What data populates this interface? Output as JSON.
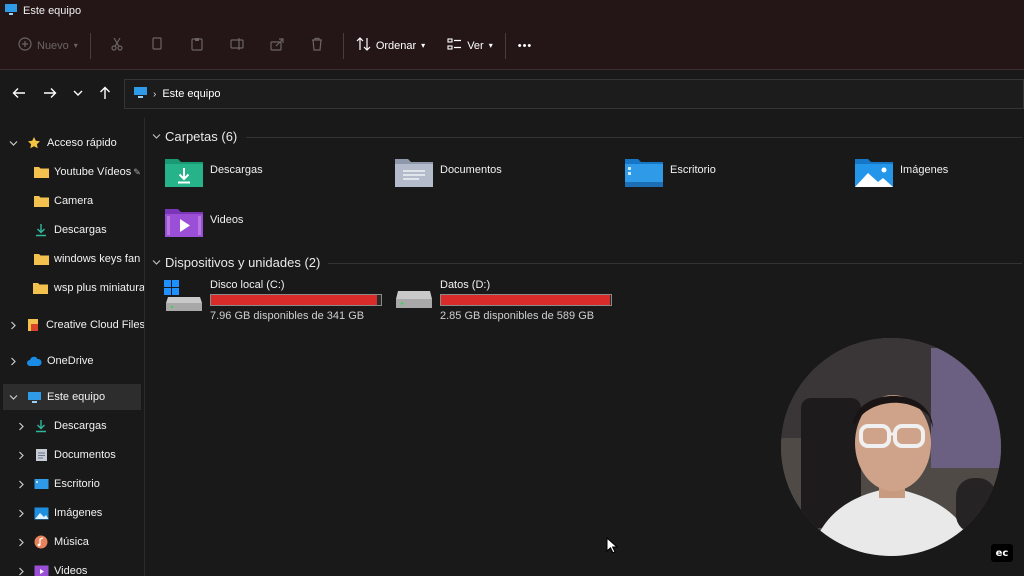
{
  "window": {
    "title": "Este equipo"
  },
  "toolbar": {
    "new_label": "Nuevo",
    "sort_label": "Ordenar",
    "view_label": "Ver",
    "more_label": "•••"
  },
  "address": {
    "crumb": "Este equipo"
  },
  "sidebar": {
    "items": [
      {
        "label": "Acceso rápido",
        "icon": "star-icon"
      },
      {
        "label": "Youtube Vídeos",
        "icon": "folder-icon"
      },
      {
        "label": "Camera",
        "icon": "folder-icon"
      },
      {
        "label": "Descargas",
        "icon": "download-icon"
      },
      {
        "label": "windows keys fan",
        "icon": "folder-icon"
      },
      {
        "label": "wsp plus miniatura",
        "icon": "folder-icon"
      },
      {
        "label": "Creative Cloud Files",
        "icon": "creative-cloud-icon"
      },
      {
        "label": "OneDrive",
        "icon": "cloud-icon"
      },
      {
        "label": "Este equipo",
        "icon": "pc-icon"
      },
      {
        "label": "Descargas",
        "icon": "download-icon"
      },
      {
        "label": "Documentos",
        "icon": "documents-icon"
      },
      {
        "label": "Escritorio",
        "icon": "desktop-icon"
      },
      {
        "label": "Imágenes",
        "icon": "pictures-icon"
      },
      {
        "label": "Música",
        "icon": "music-icon"
      },
      {
        "label": "Videos",
        "icon": "videos-icon"
      }
    ]
  },
  "content": {
    "folders_header": "Carpetas (6)",
    "folders": [
      {
        "name": "Descargas",
        "icon": "downloads-folder-icon"
      },
      {
        "name": "Documentos",
        "icon": "documents-folder-icon"
      },
      {
        "name": "Escritorio",
        "icon": "desktop-folder-icon"
      },
      {
        "name": "Imágenes",
        "icon": "pictures-folder-icon"
      },
      {
        "name": "Videos",
        "icon": "videos-folder-icon"
      }
    ],
    "drives_header": "Dispositivos y unidades (2)",
    "drives": [
      {
        "name": "Disco local (C:)",
        "free_text": "7.96 GB disponibles de 341 GB",
        "used_fraction": 0.977
      },
      {
        "name": "Datos (D:)",
        "free_text": "2.85 GB disponibles de 589 GB",
        "used_fraction": 0.995
      }
    ]
  },
  "overlay": {
    "badge": "ec"
  },
  "colors": {
    "drive_bar_full": "#da2b2b",
    "accent_blue": "#2f9be8",
    "folder_yellow": "#f2c14e"
  }
}
